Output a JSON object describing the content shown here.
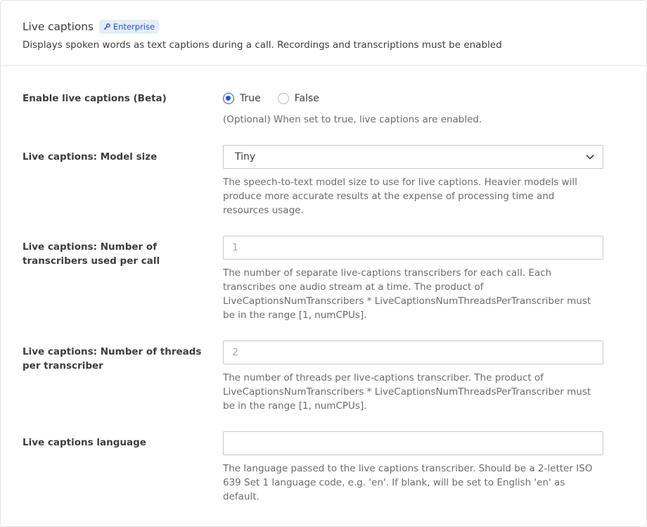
{
  "header": {
    "title": "Live captions",
    "badge": "Enterprise",
    "subtitle": "Displays spoken words as text captions during a call. Recordings and transcriptions must be enabled"
  },
  "enable": {
    "label": "Enable live captions (Beta)",
    "options": [
      "True",
      "False"
    ],
    "selected": "True",
    "help": "(Optional) When set to true, live captions are enabled."
  },
  "model_size": {
    "label": "Live captions: Model size",
    "value": "Tiny",
    "help": "The speech-to-text model size to use for live captions. Heavier models will produce more accurate results at the expense of processing time and resources usage."
  },
  "transcribers": {
    "label": "Live captions: Number of transcribers used per call",
    "placeholder": "1",
    "value": "",
    "help": "The number of separate live-captions transcribers for each call. Each transcribes one audio stream at a time. The product of LiveCaptionsNumTranscribers * LiveCaptionsNumThreadsPerTranscriber must be in the range [1, numCPUs]."
  },
  "threads": {
    "label": "Live captions: Number of threads per transcriber",
    "placeholder": "2",
    "value": "",
    "help": "The number of threads per live-captions transcriber. The product of LiveCaptionsNumTranscribers * LiveCaptionsNumThreadsPerTranscriber must be in the range [1, numCPUs]."
  },
  "language": {
    "label": "Live captions language",
    "placeholder": "",
    "value": "",
    "help": "The language passed to the live captions transcriber. Should be a 2-letter ISO 639 Set 1 language code, e.g. 'en'. If blank, will be set to English 'en' as default."
  },
  "colors": {
    "accent": "#1c58d9",
    "badge_bg": "#e5edf9",
    "border": "#e4e4e6"
  },
  "icons": {
    "badge": "key-icon",
    "select": "chevron-down-icon"
  }
}
